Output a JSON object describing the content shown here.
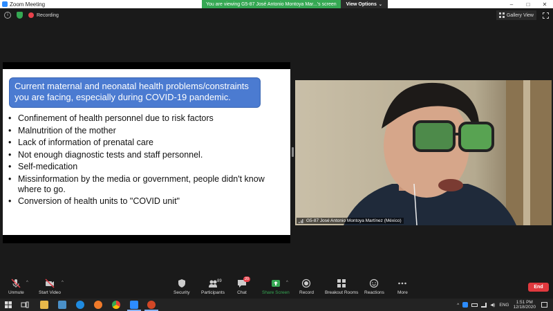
{
  "window": {
    "title": "Zoom Meeting",
    "banner": "You are viewing G5-87 José Antonio Montoya Mar...'s screen",
    "view_options": "View Options",
    "controls": [
      "–",
      "□",
      "✕"
    ]
  },
  "topbar": {
    "recording_label": "Recording",
    "gallery_view_label": "Gallery View"
  },
  "slide": {
    "heading": "Current maternal and neonatal health problems/constraints you are facing, especially during COVID-19 pandemic.",
    "bullets": [
      "Confinement of health personnel due to risk factors",
      "Malnutrition of the mother",
      "Lack of information of prenatal care",
      "Not enough diagnostic tests and staff personnel.",
      "Self-medication",
      "Missinformation by the media or government, people didn't know where to go.",
      "Conversion of health units to \"COVID unit\""
    ]
  },
  "video": {
    "participant_name": "G5-87 José Antonio Montoya Martínez (México)"
  },
  "toolbar": {
    "unmute": "Unmute",
    "start_video": "Start Video",
    "security": "Security",
    "participants": "Participants",
    "participants_count": "89",
    "chat": "Chat",
    "chat_badge": "20",
    "share_screen": "Share Screen",
    "record": "Record",
    "breakout_rooms": "Breakout Rooms",
    "reactions": "Reactions",
    "more": "More",
    "end": "End"
  },
  "taskbar": {
    "language": "ENG",
    "time": "1:51 PM",
    "date": "12/18/2020"
  },
  "colors": {
    "share_banner": "#35a853",
    "slide_heading_bg": "#4b7bd1",
    "end_button": "#e0393e",
    "recording_dot": "#e8414b"
  }
}
